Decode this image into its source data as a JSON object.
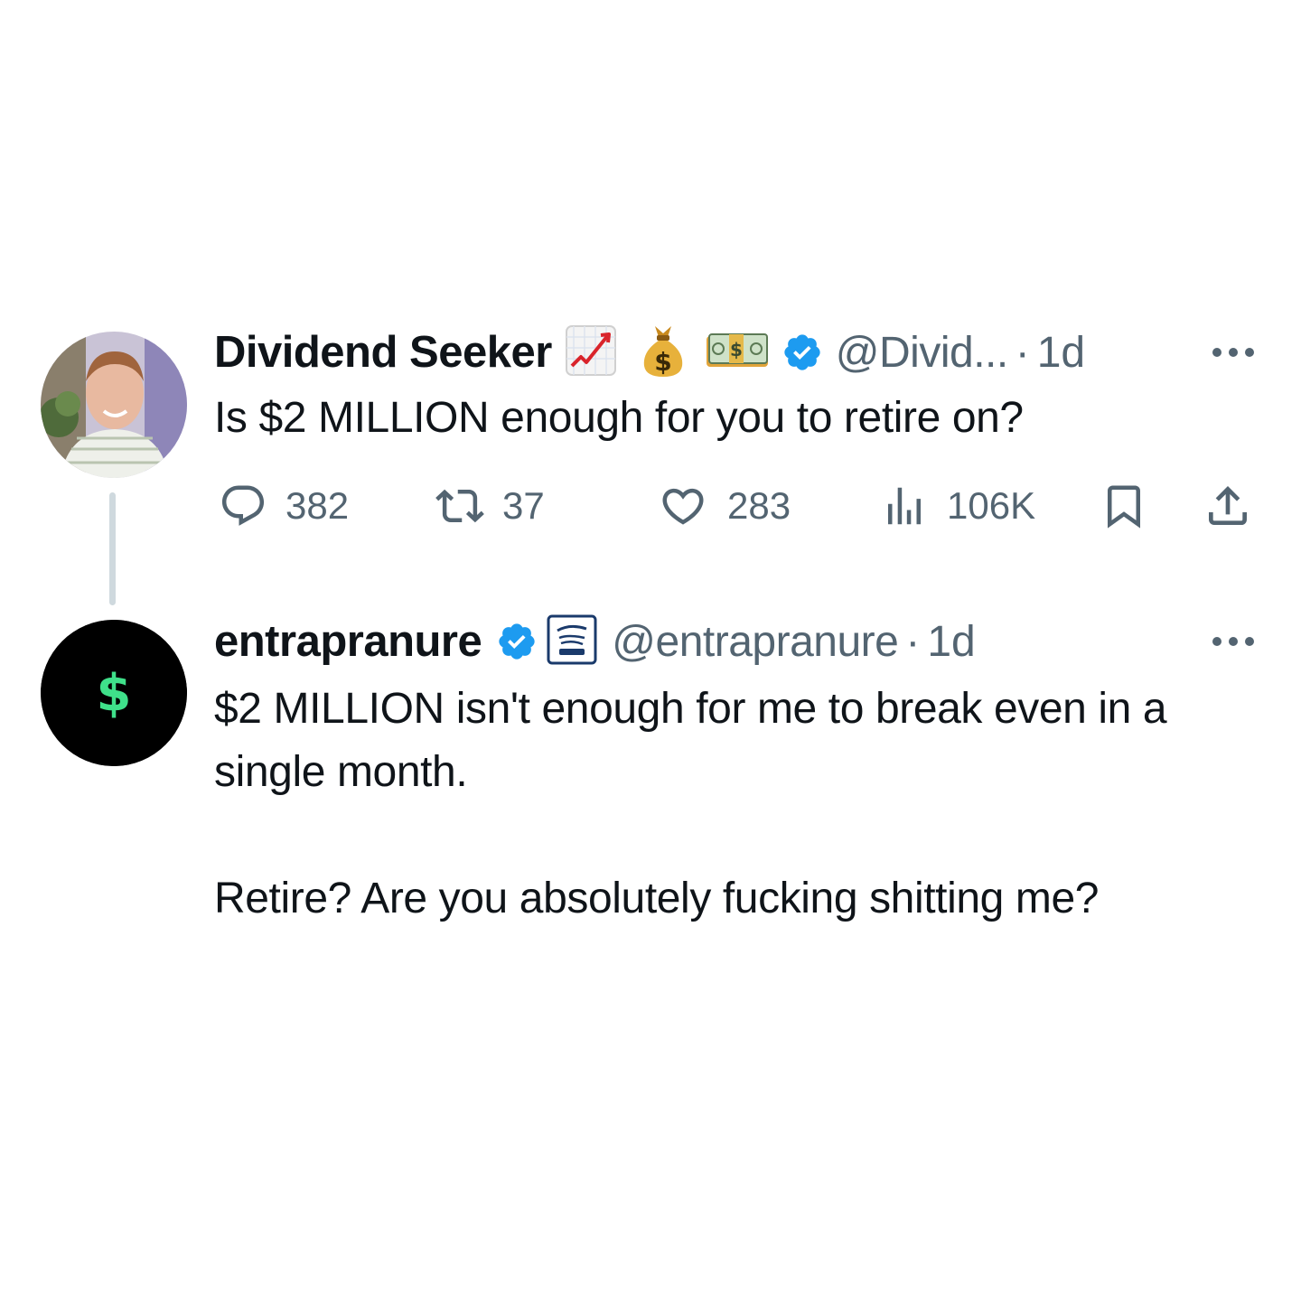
{
  "tweets": [
    {
      "display_name": "Dividend Seeker",
      "name_emojis": [
        "chart-increasing-emoji",
        "money-bag-emoji",
        "dollar-banknote-emoji"
      ],
      "verified": true,
      "handle": "@Divid...",
      "separator": "·",
      "time": "1d",
      "text": "Is $2 MILLION enough for you to retire on?",
      "stats": {
        "replies": "382",
        "retweets": "37",
        "likes": "283",
        "views": "106K"
      }
    },
    {
      "display_name": "entrapranure",
      "verified": true,
      "affiliate_badge": "friday-beers-badge",
      "handle": "@entrapranure",
      "separator": "·",
      "time": "1d",
      "text": "$2 MILLION isn't enough for me to break even in a single month.\n\nRetire? Are you absolutely fucking shitting me?",
      "avatar_symbol": "$"
    }
  ],
  "colors": {
    "verified_blue": "#1d9bf0",
    "text_primary": "#0f1419",
    "text_secondary": "#536471",
    "thread_line": "#cfd9de",
    "avatar2_bg": "#000000",
    "avatar2_symbol": "#3fe08a"
  }
}
